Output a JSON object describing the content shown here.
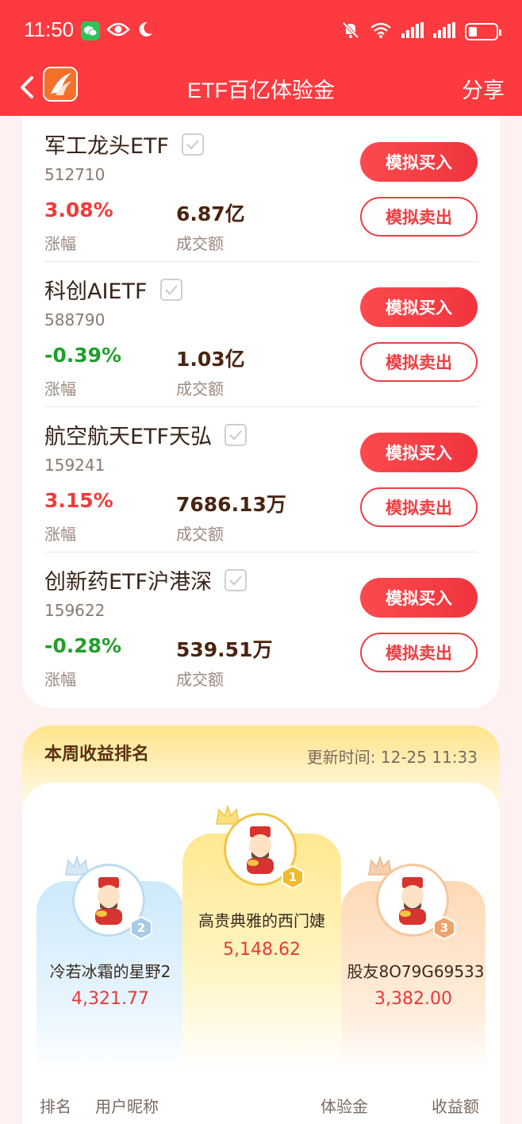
{
  "status_bar": {
    "time": "11:50"
  },
  "header": {
    "title": "ETF百亿体验金",
    "share_label": "分享"
  },
  "etf_list": {
    "change_label": "涨幅",
    "volume_label": "成交额",
    "buy_label": "模拟买入",
    "sell_label": "模拟卖出",
    "items": [
      {
        "name": "军工龙头ETF",
        "code": "512710",
        "change": "3.08%",
        "volume": "6.87亿",
        "trend": "up"
      },
      {
        "name": "科创AIETF",
        "code": "588790",
        "change": "-0.39%",
        "volume": "1.03亿",
        "trend": "down"
      },
      {
        "name": "航空航天ETF天弘",
        "code": "159241",
        "change": "3.15%",
        "volume": "7686.13万",
        "trend": "up"
      },
      {
        "name": "创新药ETF沪港深",
        "code": "159622",
        "change": "-0.28%",
        "volume": "539.51万",
        "trend": "down"
      }
    ]
  },
  "ranking": {
    "title": "本周收益排名",
    "updated": "更新时间: 12-25 11:33",
    "podium": [
      {
        "rank": "1",
        "name": "高贵典雅的西门婕",
        "score": "5,148.62"
      },
      {
        "rank": "2",
        "name": "冷若冰霜的星野2",
        "score": "4,321.77"
      },
      {
        "rank": "3",
        "name": "股友8O79G69533",
        "score": "3,382.00"
      }
    ],
    "table_headers": {
      "rank": "排名",
      "nickname": "用户昵称",
      "fund": "体验金",
      "income": "收益额"
    }
  },
  "colors": {
    "brand": "#fc3a3f",
    "up": "#f33a3a",
    "down": "#1fa02a"
  }
}
